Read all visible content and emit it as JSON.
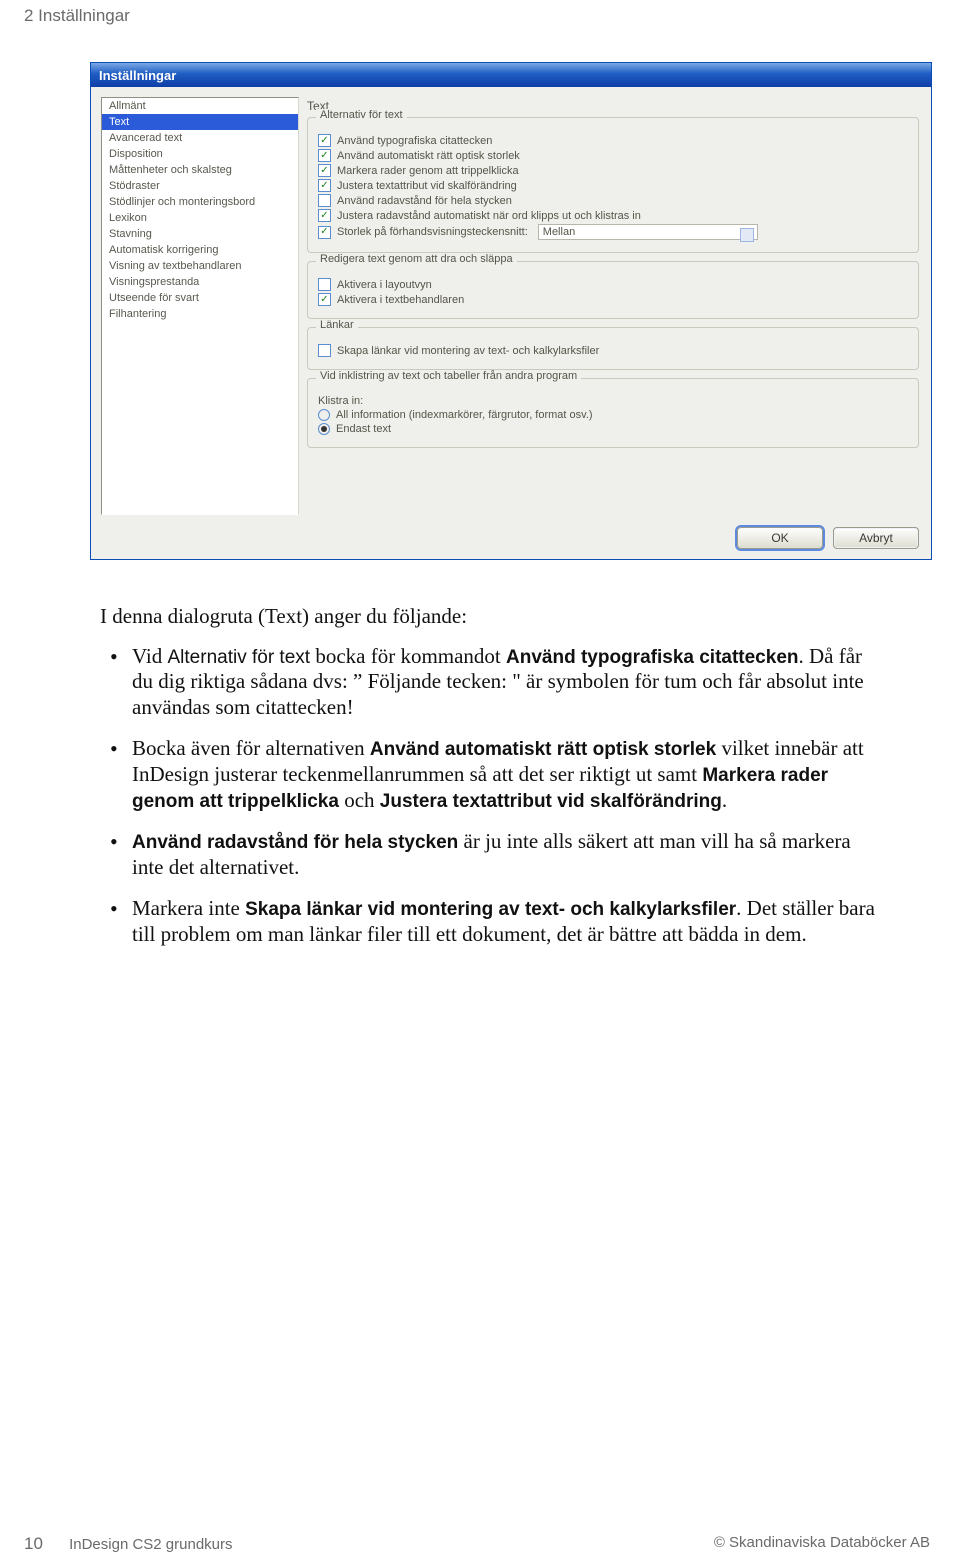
{
  "page": {
    "header": "2 Inställningar",
    "footer_left_pagenum": "10",
    "footer_left_title": "InDesign CS2 grundkurs",
    "footer_right": "© Skandinaviska Databöcker AB"
  },
  "dialog": {
    "title": "Inställningar",
    "sidebar": {
      "items": [
        "Allmänt",
        "Text",
        "Avancerad text",
        "Disposition",
        "Måttenheter och skalsteg",
        "Stödraster",
        "Stödlinjer och monteringsbord",
        "Lexikon",
        "Stavning",
        "Automatisk korrigering",
        "Visning av textbehandlaren",
        "Visningsprestanda",
        "Utseende för svart",
        "Filhantering"
      ],
      "selected_index": 1
    },
    "pane_title": "Text",
    "group_text_alternatives": {
      "legend": "Alternativ för text",
      "rows": [
        {
          "checked": true,
          "label": "Använd typografiska citattecken"
        },
        {
          "checked": true,
          "label": "Använd automatiskt rätt optisk storlek"
        },
        {
          "checked": true,
          "label": "Markera rader genom att trippelklicka"
        },
        {
          "checked": true,
          "label": "Justera textattribut vid skalförändring"
        },
        {
          "checked": false,
          "label": "Använd radavstånd för hela stycken"
        },
        {
          "checked": true,
          "label": "Justera radavstånd automatiskt när ord klipps ut och klistras in"
        }
      ],
      "preview_label": "Storlek på förhandsvisningsteckensnitt:",
      "preview_value": "Mellan"
    },
    "group_edit_drag": {
      "legend": "Redigera text genom att dra och släppa",
      "rows": [
        {
          "checked": false,
          "label": "Aktivera i layoutvyn"
        },
        {
          "checked": true,
          "label": "Aktivera i textbehandlaren"
        }
      ]
    },
    "group_links": {
      "legend": "Länkar",
      "rows": [
        {
          "checked": false,
          "label": "Skapa länkar vid montering av text- och kalkylarksfiler"
        }
      ]
    },
    "group_paste": {
      "legend": "Vid inklistring av text och tabeller från andra program",
      "subtitle": "Klistra in:",
      "radios": [
        {
          "selected": false,
          "label": "All information (indexmarkörer, färgrutor, format osv.)"
        },
        {
          "selected": true,
          "label": "Endast text"
        }
      ]
    },
    "buttons": {
      "ok": "OK",
      "cancel": "Avbryt"
    }
  },
  "content": {
    "intro": "I denna dialogruta (Text) anger du följande:",
    "b1_a": "Vid ",
    "b1_b": "Alternativ för text",
    "b1_c": " bocka för kommandot ",
    "b1_d": "Använd typografiska citattecken",
    "b1_e": ". Då får du dig riktiga sådana dvs: ” Följande tecken: \" är symbolen för tum och får absolut inte användas som citattecken!",
    "b2_a": "Bocka även för alternativen ",
    "b2_b": "Använd automatiskt rätt optisk storlek",
    "b2_c": " vilket innebär att InDesign justerar teckenmellanrummen så att det ser riktigt ut samt ",
    "b2_d": "Markera rader genom att trippelklicka",
    "b2_e": " och ",
    "b2_f": "Justera textattribut vid skalförändring",
    "b2_g": ".",
    "b3_a": "Använd radavstånd för hela stycken",
    "b3_b": " är ju inte alls säkert att man vill ha så markera inte det alternativet.",
    "b4_a": "Markera inte ",
    "b4_b": "Skapa länkar vid montering av text- och kalkylarksfiler",
    "b4_c": ". Det ställer bara till problem om man länkar filer till ett dokument, det är bättre att bädda in dem."
  }
}
